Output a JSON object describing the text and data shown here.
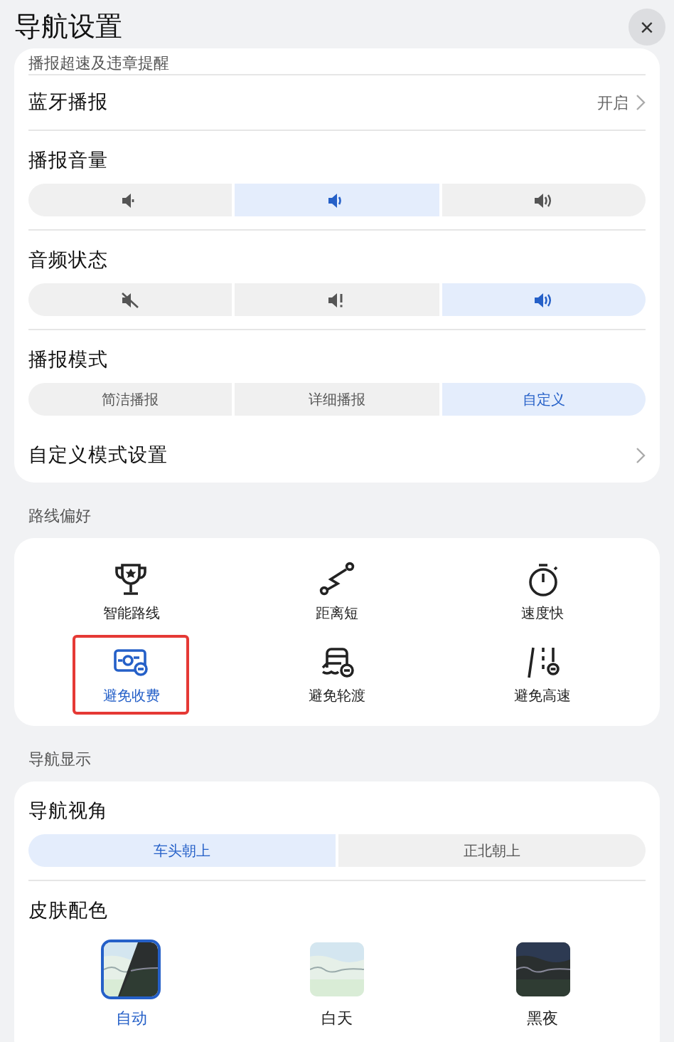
{
  "header": {
    "title": "导航设置",
    "close": "×"
  },
  "broadcast": {
    "cut_row": "播报超速及违章提醒",
    "bluetooth": {
      "label": "蓝牙播报",
      "value": "开启"
    },
    "volume": {
      "label": "播报音量",
      "options": [
        {
          "selected": false
        },
        {
          "selected": true
        },
        {
          "selected": false
        }
      ]
    },
    "audio_state": {
      "label": "音频状态",
      "options": [
        {
          "selected": false
        },
        {
          "selected": false
        },
        {
          "selected": true
        }
      ]
    },
    "mode": {
      "label": "播报模式",
      "options": [
        {
          "label": "简洁播报",
          "selected": false
        },
        {
          "label": "详细播报",
          "selected": false
        },
        {
          "label": "自定义",
          "selected": true
        }
      ]
    },
    "custom": {
      "label": "自定义模式设置"
    }
  },
  "route_preference": {
    "heading": "路线偏好",
    "items": [
      {
        "kind": "trophy",
        "label": "智能路线",
        "selected": false
      },
      {
        "kind": "path",
        "label": "距离短",
        "selected": false
      },
      {
        "kind": "timer",
        "label": "速度快",
        "selected": false
      },
      {
        "kind": "toll",
        "label": "避免收费",
        "selected": true
      },
      {
        "kind": "ferry",
        "label": "避免轮渡",
        "selected": false
      },
      {
        "kind": "highway",
        "label": "避免高速",
        "selected": false
      }
    ]
  },
  "display": {
    "heading": "导航显示",
    "view": {
      "label": "导航视角",
      "options": [
        {
          "label": "车头朝上",
          "selected": true
        },
        {
          "label": "正北朝上",
          "selected": false
        }
      ]
    },
    "skin": {
      "label": "皮肤配色",
      "options": [
        {
          "kind": "auto",
          "label": "自动",
          "selected": true
        },
        {
          "kind": "day",
          "label": "白天",
          "selected": false
        },
        {
          "kind": "night",
          "label": "黑夜",
          "selected": false
        }
      ]
    }
  }
}
